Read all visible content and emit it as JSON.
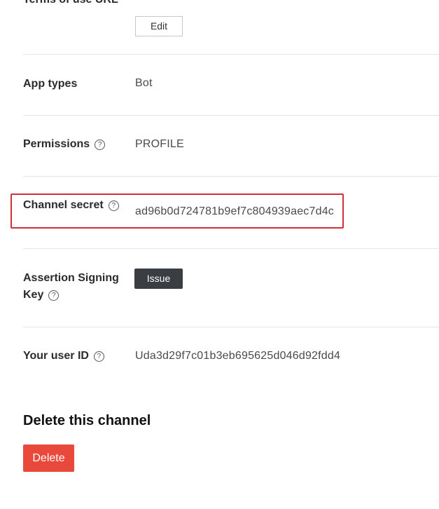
{
  "top_row": {
    "label": "Terms of use URL",
    "edit_label": "Edit"
  },
  "rows": {
    "app_types": {
      "label": "App types",
      "value": "Bot"
    },
    "permissions": {
      "label": "Permissions",
      "value": "PROFILE",
      "help": "?"
    },
    "channel_secret": {
      "label": "Channel secret",
      "value": "ad96b0d724781b9ef7c804939aec7d4c",
      "help": "?"
    },
    "assertion_key": {
      "label_line1": "Assertion Signing",
      "label_line2": "Key",
      "button_label": "Issue",
      "help": "?"
    },
    "user_id": {
      "label": "Your user ID",
      "value": "Uda3d29f7c01b3eb695625d046d92fdd4",
      "help": "?"
    }
  },
  "delete_section": {
    "title": "Delete this channel",
    "button_label": "Delete"
  },
  "colors": {
    "highlight": "#d22f3a",
    "issue_button": "#3a3d42",
    "delete_button": "#e8493a"
  }
}
